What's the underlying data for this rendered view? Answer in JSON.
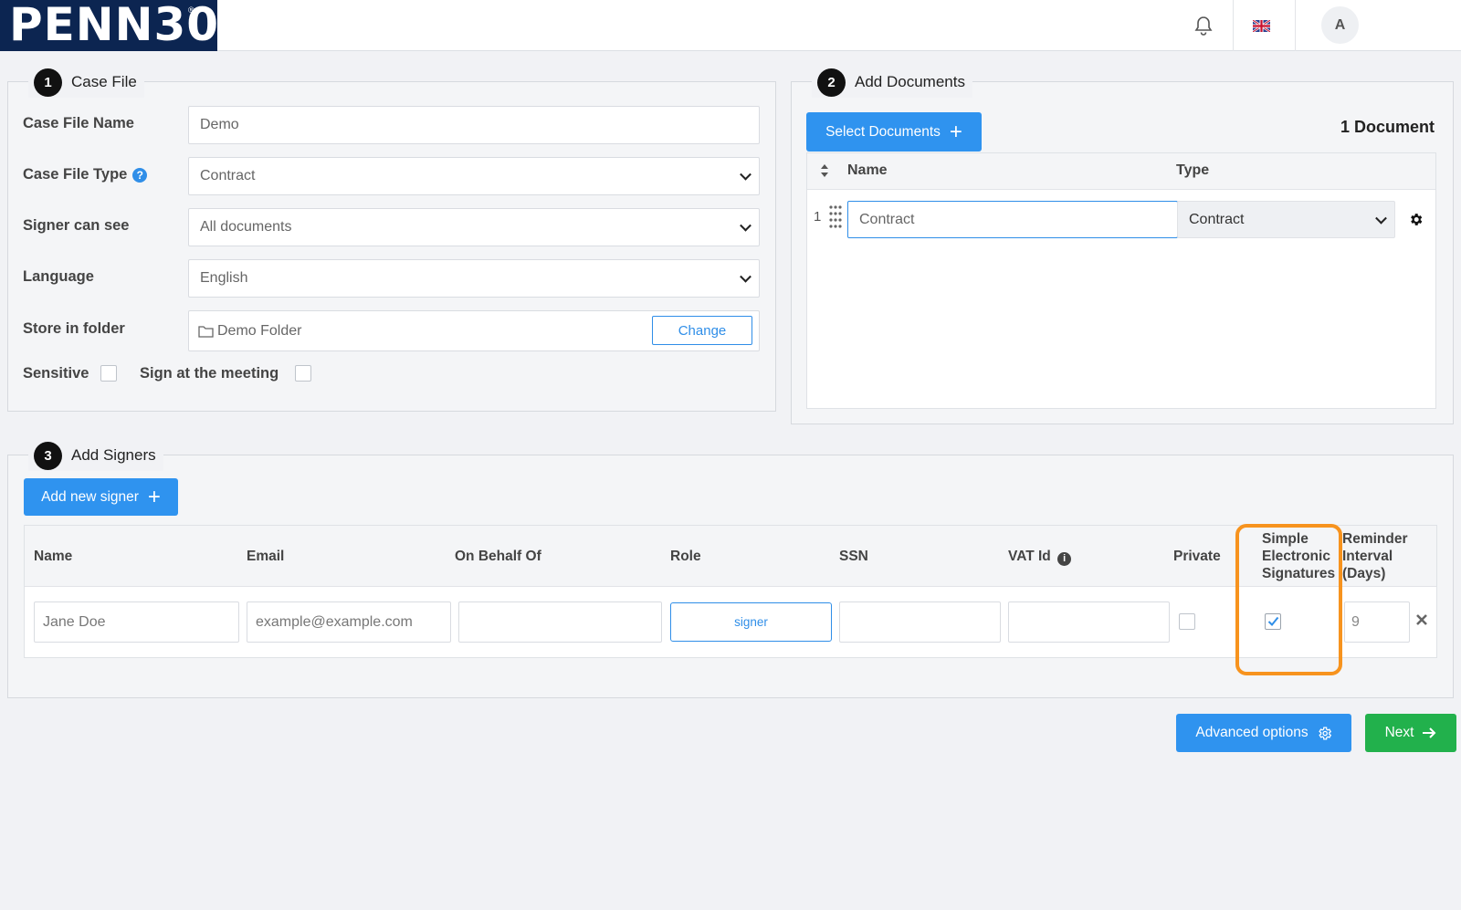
{
  "header": {
    "logo_text": "PENN30",
    "logo_mark": "®",
    "user_initial": "A",
    "icons": [
      "bell-icon",
      "uk-flag-icon"
    ]
  },
  "case_file": {
    "step": "1",
    "title": "Case File",
    "name_label": "Case File Name",
    "name_value": "Demo",
    "type_label": "Case File Type",
    "type_value": "Contract",
    "signer_see_label": "Signer can see",
    "signer_see_value": "All documents",
    "language_label": "Language",
    "language_value": "English",
    "folder_label": "Store in folder",
    "folder_value": "Demo Folder",
    "change_label": "Change",
    "sensitive_label": "Sensitive",
    "sign_meeting_label": "Sign at the meeting"
  },
  "documents": {
    "step": "2",
    "title": "Add Documents",
    "select_label": "Select Documents",
    "count_label": "1 Document",
    "col_name": "Name",
    "col_type": "Type",
    "rows": [
      {
        "index": "1",
        "name": "Contract",
        "type": "Contract"
      }
    ]
  },
  "signers": {
    "step": "3",
    "title": "Add Signers",
    "add_label": "Add new signer",
    "columns": {
      "name": "Name",
      "email": "Email",
      "behalf": "On Behalf Of",
      "role": "Role",
      "ssn": "SSN",
      "vat": "VAT Id",
      "private": "Private",
      "ses_1": "Simple",
      "ses_2": "Electronic",
      "ses_3": "Signatures",
      "rem_1": "Reminder",
      "rem_2": "Interval",
      "rem_3": "(Days)"
    },
    "row": {
      "name_placeholder": "Jane Doe",
      "email_placeholder": "example@example.com",
      "role": "signer",
      "private_checked": false,
      "ses_checked": true,
      "reminder": "9"
    }
  },
  "footer": {
    "advanced_label": "Advanced options",
    "next_label": "Next"
  },
  "colors": {
    "brand_navy": "#0c2551",
    "primary_blue": "#2f93ef",
    "success_green": "#22b14c",
    "highlight_orange": "#f7931e"
  }
}
